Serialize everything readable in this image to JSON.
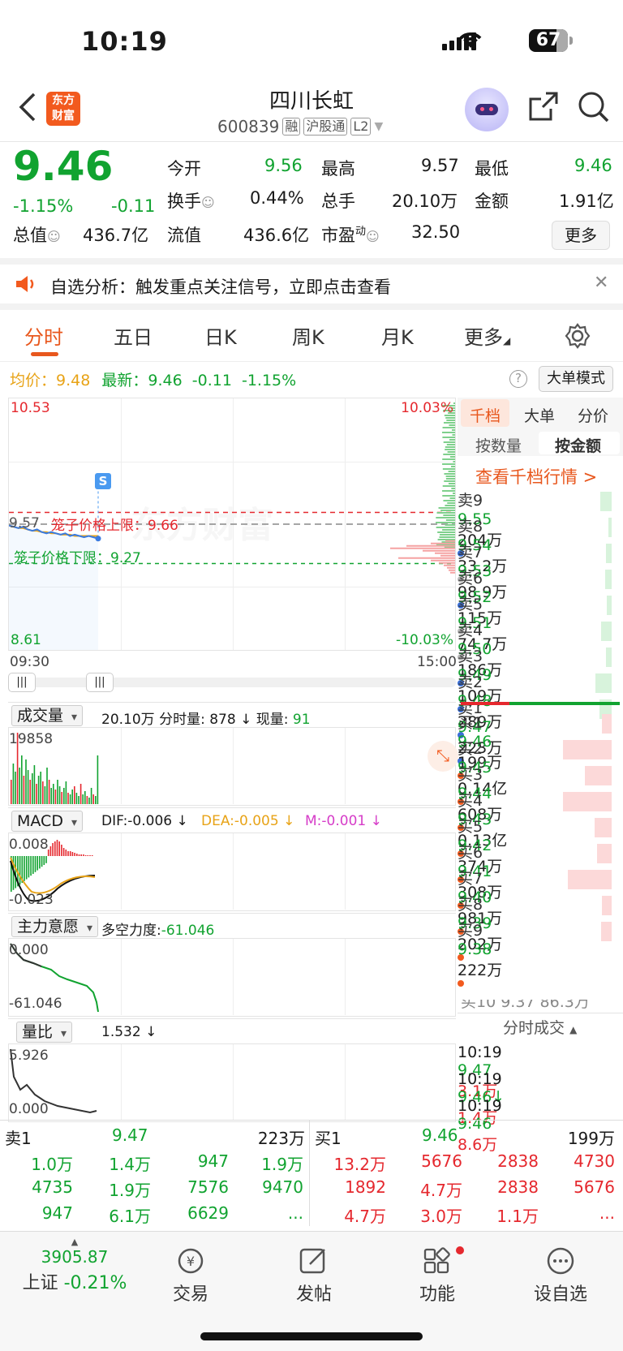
{
  "status_bar": {
    "time": "10:19",
    "battery": "67"
  },
  "header": {
    "logo_line1": "东方",
    "logo_line2": "财富",
    "stock_name": "四川长虹",
    "stock_code": "600839",
    "tags": [
      "融",
      "沪股通",
      "L2"
    ]
  },
  "quote": {
    "price": "9.46",
    "change_pct": "-1.15%",
    "change": "-0.11",
    "fields": [
      {
        "label": "今开",
        "value": "9.56"
      },
      {
        "label": "最高",
        "value": "9.57"
      },
      {
        "label": "最低",
        "value": "9.46"
      },
      {
        "label": "换手",
        "value": "0.44%"
      },
      {
        "label": "总手",
        "value": "20.10万"
      },
      {
        "label": "金额",
        "value": "1.91亿"
      },
      {
        "label": "总值",
        "value": "436.7亿"
      },
      {
        "label": "流值",
        "value": "436.6亿"
      },
      {
        "label": "市盈",
        "value": "32.50"
      }
    ],
    "pe_suffix": "动",
    "more_label": "更多"
  },
  "notice": {
    "text": "自选分析：触发重点关注信号，立即点击查看"
  },
  "tabs": [
    "分时",
    "五日",
    "日K",
    "周K",
    "月K",
    "更多"
  ],
  "chart_header": {
    "avg_label": "均价：",
    "avg_value": "9.48",
    "latest_label": "最新：",
    "latest_value": "9.46",
    "latest_change": "-0.11",
    "latest_pct": "-1.15%",
    "help": "?",
    "mode_button": "大单模式"
  },
  "chart_data": {
    "type": "line",
    "y_top": "10.53",
    "y_bottom": "8.61",
    "pct_top": "10.03%",
    "pct_bottom": "-10.03%",
    "ref_price": "9.57",
    "upper_limit_label": "笼子价格上限：9.66",
    "lower_limit_label": "笼子价格下限：9.27",
    "x_start": "09:30",
    "x_end": "15:00",
    "watermark": "东方财富",
    "signal_marker": "S",
    "ylim": [
      8.61,
      10.53
    ],
    "price": [
      9.56,
      9.55,
      9.54,
      9.55,
      9.53,
      9.52,
      9.53,
      9.51,
      9.5,
      9.51,
      9.5,
      9.49,
      9.5,
      9.48,
      9.49,
      9.48,
      9.47,
      9.48,
      9.47,
      9.46
    ],
    "avg": [
      9.56,
      9.55,
      9.54,
      9.54,
      9.53,
      9.52,
      9.52,
      9.51,
      9.51,
      9.5,
      9.5,
      9.49,
      9.49,
      9.49,
      9.48,
      9.48,
      9.48,
      9.48,
      9.48,
      9.48
    ]
  },
  "volume": {
    "label": "成交量",
    "total": "20.10万",
    "detail_label": "分时量:",
    "detail_value": "878",
    "cur_label": "现量:",
    "cur_value": "91",
    "max": "19858"
  },
  "macd": {
    "label": "MACD",
    "dif": "DIF:-0.006 ↓",
    "dea": "DEA:-0.005 ↓",
    "m": "M:-0.001 ↓",
    "top": "0.008",
    "bottom": "-0.023"
  },
  "main_force": {
    "label": "主力意愿",
    "text": "多空力度:",
    "value": "-61.046",
    "top": "0.000",
    "bottom": "-61.046"
  },
  "volume_ratio": {
    "label": "量比",
    "value": "1.532 ↓",
    "top": "5.926",
    "bottom": "0.000"
  },
  "orderbook": {
    "tabs": [
      "千档",
      "大单",
      "分价"
    ],
    "subtabs": [
      "按数量",
      "按金额"
    ],
    "link": "查看千档行情 >",
    "asks": [
      {
        "label": "卖9",
        "price": "9.55",
        "amount": "204万"
      },
      {
        "label": "卖8",
        "price": "9.54",
        "amount": "33.2万"
      },
      {
        "label": "卖7",
        "price": "9.53",
        "amount": "98.9万"
      },
      {
        "label": "卖6",
        "price": "9.52",
        "amount": "115万"
      },
      {
        "label": "卖5",
        "price": "9.51",
        "amount": "74.7万"
      },
      {
        "label": "卖4",
        "price": "9.50",
        "amount": "186万"
      },
      {
        "label": "卖3",
        "price": "9.49",
        "amount": "109万"
      },
      {
        "label": "卖2",
        "price": "9.48",
        "amount": "289万"
      },
      {
        "label": "卖1",
        "price": "9.47",
        "amount": "223万"
      }
    ],
    "bids": [
      {
        "label": "买1",
        "price": "9.46",
        "amount": "199万"
      },
      {
        "label": "买2",
        "price": "9.45",
        "amount": "0.14亿"
      },
      {
        "label": "买3",
        "price": "9.44",
        "amount": "608万"
      },
      {
        "label": "买4",
        "price": "9.43",
        "amount": "0.13亿"
      },
      {
        "label": "买5",
        "price": "9.42",
        "amount": "374万"
      },
      {
        "label": "买6",
        "price": "9.41",
        "amount": "308万"
      },
      {
        "label": "买7",
        "price": "9.40",
        "amount": "981万"
      },
      {
        "label": "买8",
        "price": "9.39",
        "amount": "202万"
      },
      {
        "label": "买9",
        "price": "9.38",
        "amount": "222万"
      }
    ],
    "partial_row": "买10  9.37 86.3万",
    "ticks_title": "分时成交",
    "ticks": [
      {
        "time": "10:19",
        "price": "9.47",
        "vol": "3.1万"
      },
      {
        "time": "10:19",
        "price": "9.46↓",
        "vol": "1.4万"
      },
      {
        "time": "10:19",
        "price": "9.46",
        "vol": "8.6万"
      }
    ]
  },
  "trades": {
    "ask_label": "卖1",
    "ask_price": "9.47",
    "ask_amount": "223万",
    "bid_label": "买1",
    "bid_price": "9.46",
    "bid_amount": "199万",
    "ask_rows": [
      [
        "1.0万",
        "1.4万",
        "947",
        "1.9万"
      ],
      [
        "4735",
        "1.9万",
        "7576",
        "9470"
      ],
      [
        "947",
        "6.1万",
        "6629",
        "..."
      ]
    ],
    "bid_rows": [
      [
        "13.2万",
        "5676",
        "2838",
        "4730"
      ],
      [
        "1892",
        "4.7万",
        "2838",
        "5676"
      ],
      [
        "4.7万",
        "3.0万",
        "1.1万",
        "..."
      ]
    ]
  },
  "bottom_nav": {
    "index_value": "3905.87",
    "index_name": "上证",
    "index_change": "-0.21%",
    "items": [
      "交易",
      "发帖",
      "功能",
      "设自选"
    ]
  }
}
